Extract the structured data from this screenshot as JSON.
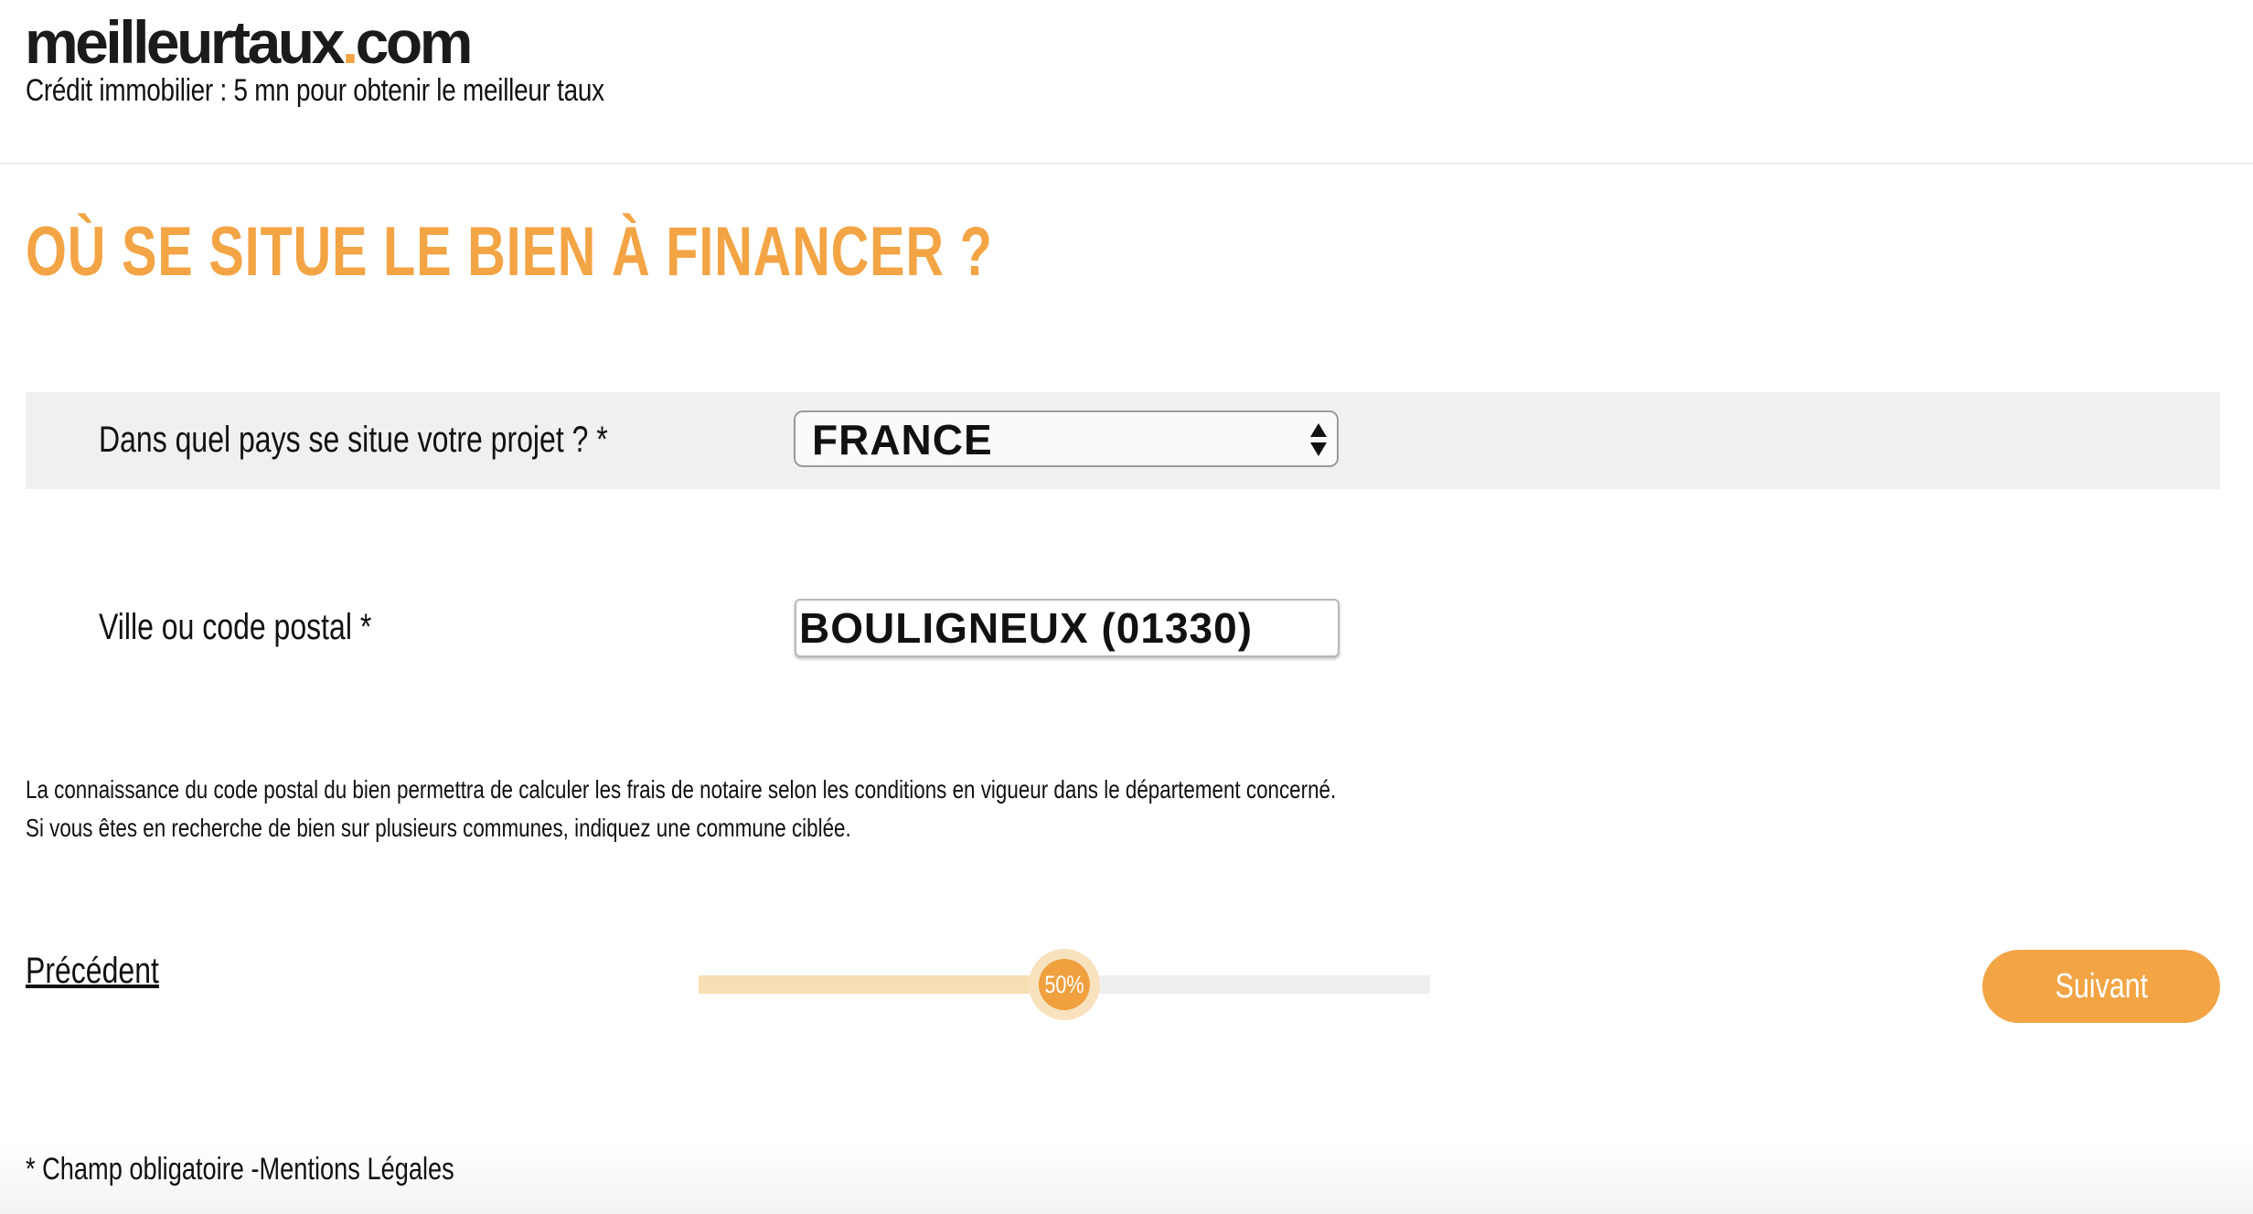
{
  "header": {
    "logo_main": "meilleurtaux",
    "logo_dot": ".",
    "logo_suffix": "com",
    "tagline": "Crédit immobilier : 5 mn pour obtenir le meilleur taux"
  },
  "page": {
    "title": "OÙ SE SITUE LE BIEN À FINANCER ?"
  },
  "form": {
    "country": {
      "label": "Dans quel pays se situe votre projet ? *",
      "selected": "FRANCE"
    },
    "city": {
      "label": "Ville ou code postal *",
      "value": "BOULIGNEUX (01330)"
    },
    "help": {
      "line1": "La connaissance du code postal du bien permettra de calculer les frais de notaire selon les conditions en vigueur dans le département concerné.",
      "line2": "Si vous êtes en recherche de bien sur plusieurs communes, indiquez une commune ciblée."
    }
  },
  "navigation": {
    "prev_label": "Précédent",
    "next_label": "Suivant",
    "progress_percent": 50,
    "progress_text": "50%"
  },
  "footer": {
    "required_note": "* Champ obligatoire",
    "separator": " -",
    "legal_link": "Mentions Légales"
  },
  "colors": {
    "accent": "#f3a444",
    "progress_fill": "#f6dfb5",
    "row_background": "#f0f0f0"
  }
}
